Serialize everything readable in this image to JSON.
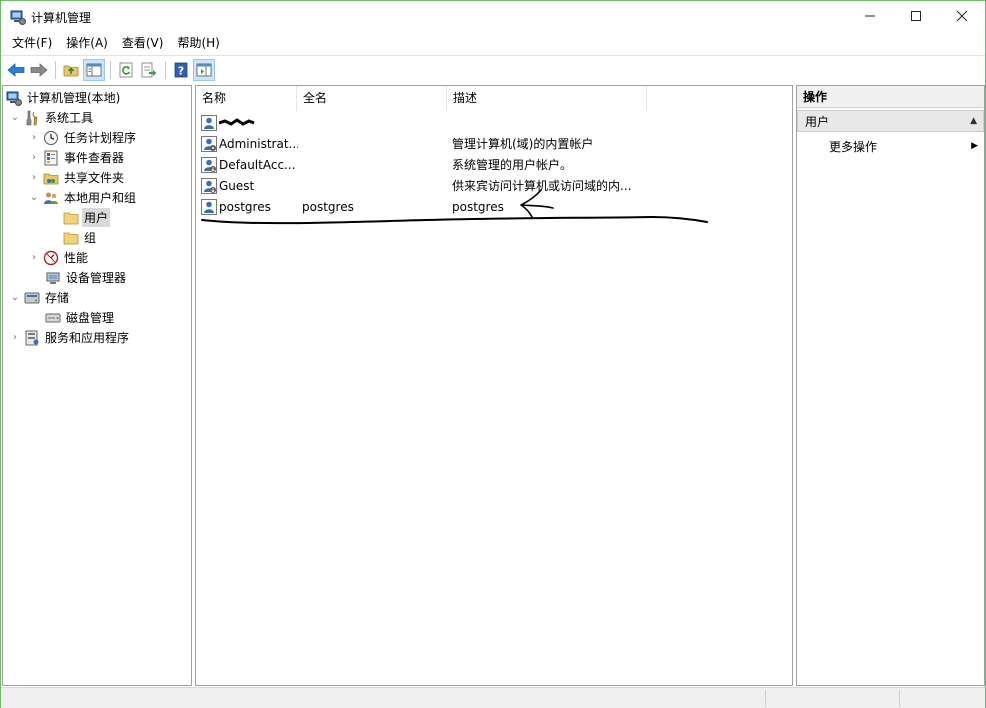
{
  "window": {
    "title": "计算机管理",
    "controls": {
      "minimize": "—",
      "maximize": "☐",
      "close": "✕"
    }
  },
  "menu": [
    {
      "label": "文件(F)"
    },
    {
      "label": "操作(A)"
    },
    {
      "label": "查看(V)"
    },
    {
      "label": "帮助(H)"
    }
  ],
  "toolbar": {
    "buttons": [
      "back-icon",
      "forward-icon",
      "up-folder-icon",
      "show-hide-tree-icon",
      "refresh-icon",
      "export-list-icon",
      "help-icon",
      "show-hide-action-pane-icon"
    ]
  },
  "tree": {
    "items": [
      {
        "label": "计算机管理(本地)",
        "icon": "computer-management-icon"
      },
      {
        "label": "系统工具",
        "icon": "tools-icon"
      },
      {
        "label": "任务计划程序",
        "icon": "clock-icon"
      },
      {
        "label": "事件查看器",
        "icon": "event-viewer-icon"
      },
      {
        "label": "共享文件夹",
        "icon": "shared-folder-icon"
      },
      {
        "label": "本地用户和组",
        "icon": "users-group-icon"
      },
      {
        "label": "用户",
        "icon": "folder-icon"
      },
      {
        "label": "组",
        "icon": "folder-icon"
      },
      {
        "label": "性能",
        "icon": "performance-icon"
      },
      {
        "label": "设备管理器",
        "icon": "device-manager-icon"
      },
      {
        "label": "存储",
        "icon": "storage-icon"
      },
      {
        "label": "磁盘管理",
        "icon": "disk-icon"
      },
      {
        "label": "服务和应用程序",
        "icon": "services-icon"
      }
    ]
  },
  "list": {
    "columns": [
      "名称",
      "全名",
      "描述"
    ],
    "rows": [
      {
        "name": "",
        "full_name": "",
        "description": ""
      },
      {
        "name": "Administrat...",
        "full_name": "",
        "description": "管理计算机(域)的内置帐户"
      },
      {
        "name": "DefaultAcc...",
        "full_name": "",
        "description": "系统管理的用户帐户。"
      },
      {
        "name": "Guest",
        "full_name": "",
        "description": "供来宾访问计算机或访问域的内..."
      },
      {
        "name": "postgres",
        "full_name": "postgres",
        "description": "postgres"
      }
    ]
  },
  "actions": {
    "title": "操作",
    "section": "用户",
    "more": "更多操作"
  },
  "colors": {
    "window_border": "#6cb96c",
    "selection": "#d9d9d9",
    "toolbar_pressed": "#cce4f7",
    "annotation_ink": "#000000"
  }
}
